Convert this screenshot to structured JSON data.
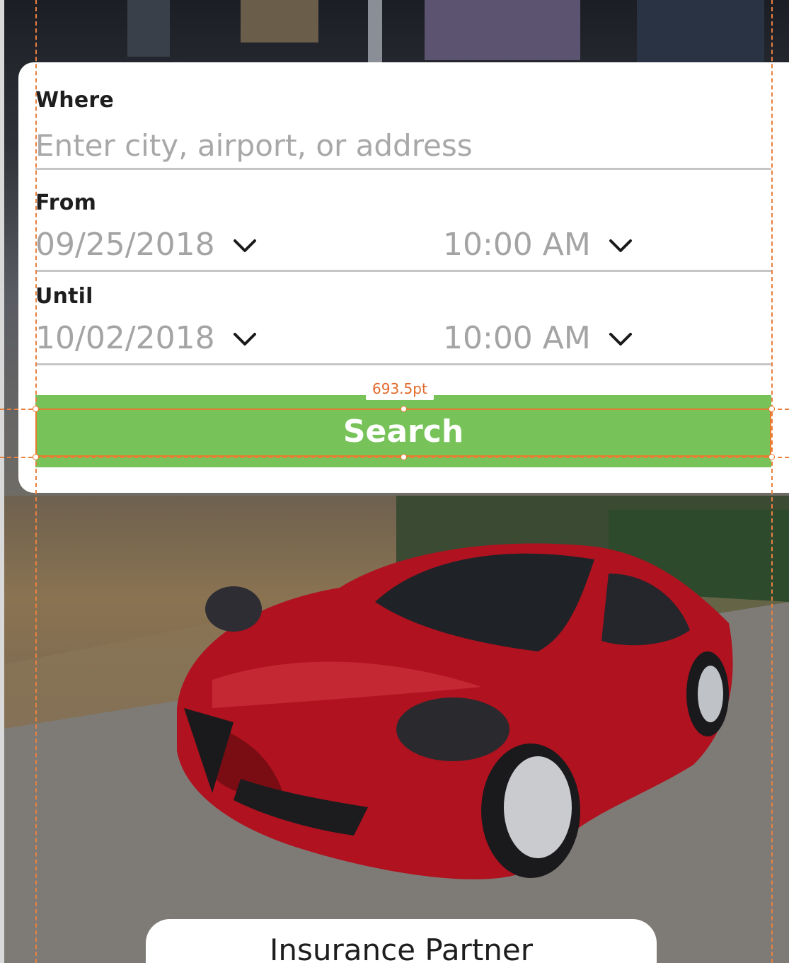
{
  "search_form": {
    "where": {
      "label": "Where",
      "placeholder": "Enter city, airport, or address",
      "value": ""
    },
    "from": {
      "label": "From",
      "date": "09/25/2018",
      "time": "10:00 AM"
    },
    "until": {
      "label": "Until",
      "date": "10/02/2018",
      "time": "10:00 AM"
    },
    "search_label": "Search"
  },
  "design_overlay": {
    "width_measurement": "693.5pt"
  },
  "insurance_label": "Insurance Partner",
  "colors": {
    "search_button": "#77c35a",
    "card": "#ffffff",
    "guide_line": "#e9803f",
    "placeholder_text": "#a4a4a4"
  },
  "icons": {
    "dropdown": "chevron-down-icon"
  }
}
